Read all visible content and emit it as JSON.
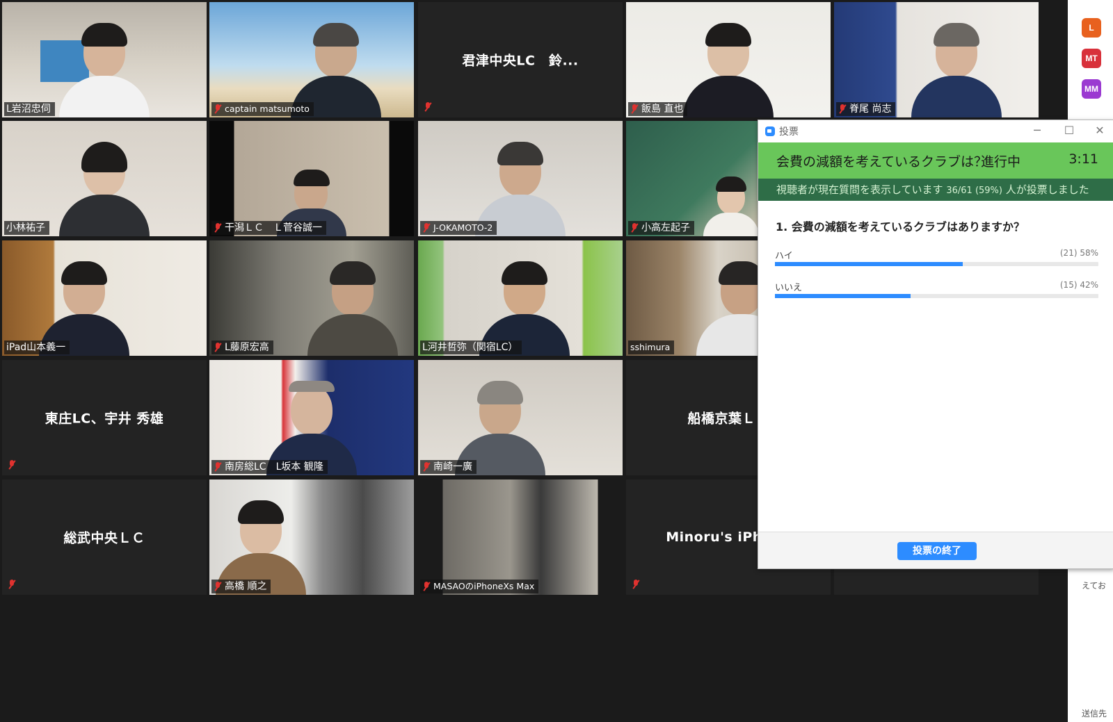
{
  "tiles": [
    {
      "name": "L岩沼忠伺",
      "muted": false
    },
    {
      "name": "captain matsumoto",
      "muted": true
    },
    {
      "name": "君津中央LC　鈴...",
      "muted": true
    },
    {
      "name": "飯島 直也",
      "muted": true
    },
    {
      "name": "脊尾 尚志",
      "muted": true
    },
    {
      "name": "小林祐子",
      "muted": false
    },
    {
      "name": "干潟ＬＣ　Ｌ菅谷誠一",
      "muted": true
    },
    {
      "name": "J-OKAMOTO-2",
      "muted": true
    },
    {
      "name": "小高左起子",
      "muted": true
    },
    {
      "name": "iPad山本義一",
      "muted": false
    },
    {
      "name": "L藤原宏高",
      "muted": true
    },
    {
      "name": "L河井哲弥（関宿LC）",
      "muted": false
    },
    {
      "name": "sshimura",
      "muted": false
    },
    {
      "name": "東庄LC、宇井 秀雄",
      "muted": true
    },
    {
      "name": "南房総LC　L坂本 観隆",
      "muted": true
    },
    {
      "name": "南崎一廣",
      "muted": true
    },
    {
      "name": "船橋京葉ＬＣ",
      "muted": false
    },
    {
      "name": "総武中央ＬＣ",
      "muted": true
    },
    {
      "name": "高橋 順之",
      "muted": true
    },
    {
      "name": "MASAOのiPhoneXs Max",
      "muted": true
    },
    {
      "name": "Minoru's iPhone",
      "muted": true
    }
  ],
  "chat": {
    "avatars": [
      "L",
      "MT",
      "MM"
    ],
    "avatar_colors": [
      "#e8611e",
      "#d8313b",
      "#9b3ad1"
    ],
    "snippet": "えてお",
    "send_to": "送信先"
  },
  "poll": {
    "window_title": "投票",
    "title": "会費の減額を考えているクラブは？",
    "status": "進行中",
    "timer": "3:11",
    "subtitle": "視聴者が現在質問を表示しています",
    "vote_count": "36/61 (59%)",
    "subtitle_suffix": "人が投票しました",
    "question": "1. 会費の減額を考えているクラブはありますか？",
    "answers": [
      {
        "label": "ハイ",
        "result": "(21) 58%",
        "percent": 58
      },
      {
        "label": "いいえ",
        "result": "(15) 42%",
        "percent": 42
      }
    ],
    "end_button": "投票の終了",
    "accent_color": "#2d8cff",
    "header_color": "#69c65a"
  }
}
